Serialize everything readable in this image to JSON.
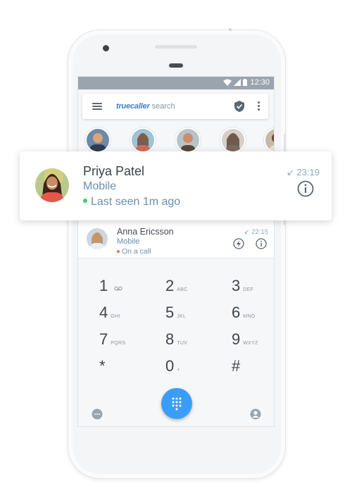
{
  "status_bar": {
    "time": "12:30"
  },
  "search": {
    "brand": "truecaller",
    "placeholder": "search"
  },
  "highlight_card": {
    "name": "Priya Patel",
    "type": "Mobile",
    "status": "Last seen 1m ago",
    "time": "23:19"
  },
  "contact_row": {
    "name": "Anna Ericsson",
    "type": "Mobile",
    "status": "On a call",
    "time": "22:15"
  },
  "dialpad": {
    "keys": [
      {
        "num": "1",
        "sub": ""
      },
      {
        "num": "2",
        "sub": "ABC"
      },
      {
        "num": "3",
        "sub": "DEF"
      },
      {
        "num": "4",
        "sub": "GHI"
      },
      {
        "num": "5",
        "sub": "JKL"
      },
      {
        "num": "6",
        "sub": "MNO"
      },
      {
        "num": "7",
        "sub": "PQRS"
      },
      {
        "num": "8",
        "sub": "TUV"
      },
      {
        "num": "9",
        "sub": "WXYZ"
      },
      {
        "num": "*",
        "sub": ""
      },
      {
        "num": "0",
        "sub": "+"
      },
      {
        "num": "#",
        "sub": ""
      }
    ]
  },
  "colors": {
    "accent": "#3b9dfb",
    "online": "#3ecb6f",
    "busy": "#ff6a3d",
    "secondary_text": "#6a8fae"
  },
  "icons": [
    "menu-icon",
    "shield-icon",
    "more-icon",
    "voicemail-icon",
    "flash-icon",
    "info-icon",
    "chat-icon",
    "dialpad-icon",
    "profile-icon",
    "missed-call-icon"
  ]
}
